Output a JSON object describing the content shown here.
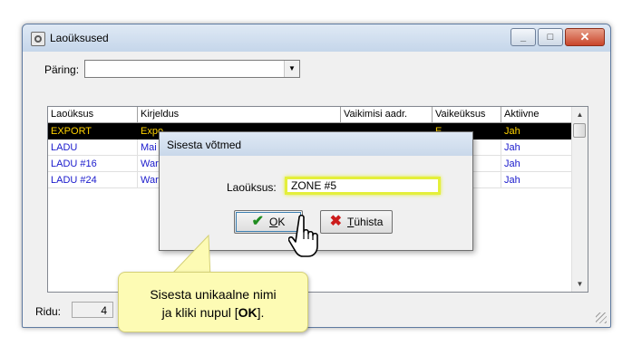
{
  "window": {
    "title": "Laoüksused",
    "controls": {
      "minimize": "▭",
      "maximize": "□",
      "close": "✕"
    }
  },
  "query": {
    "label": "Päring:",
    "value": ""
  },
  "grid": {
    "columns": [
      "Laoüksus",
      "Kirjeldus",
      "Vaikimisi aadr.",
      "Vaikeüksus",
      "Aktiivne"
    ],
    "rows": [
      {
        "unit": "EXPORT",
        "description": "Expo",
        "address": "",
        "default_unit": "E",
        "active": "Jah",
        "selected": true
      },
      {
        "unit": "LADU",
        "description": "Mai",
        "address": "",
        "default_unit": "",
        "active": "Jah",
        "selected": false
      },
      {
        "unit": "LADU #16",
        "description": "War",
        "address": "",
        "default_unit": "",
        "active": "Jah",
        "selected": false
      },
      {
        "unit": "LADU #24",
        "description": "War",
        "address": "",
        "default_unit": "",
        "active": "Jah",
        "selected": false
      }
    ]
  },
  "footer": {
    "count_label": "Ridu:",
    "count_value": "4"
  },
  "dialog": {
    "title": "Sisesta võtmed",
    "field_label": "Laoüksus:",
    "field_value": "ZONE #5",
    "ok_label": "OK",
    "ok_accel": "O",
    "ok_rest": "K",
    "cancel_accel": "T",
    "cancel_rest": "ühista"
  },
  "callout": {
    "line1": "Sisesta unikaalne nimi",
    "line2_pre": "ja kliki nupul [",
    "line2_bold": "OK",
    "line2_post": "]."
  },
  "colors": {
    "selected_row_bg": "#000000",
    "selected_row_text": "#ffd200",
    "row_text": "#1a1acc",
    "highlight": "#e4ef3a",
    "callout_bg": "#fdfbb4"
  }
}
